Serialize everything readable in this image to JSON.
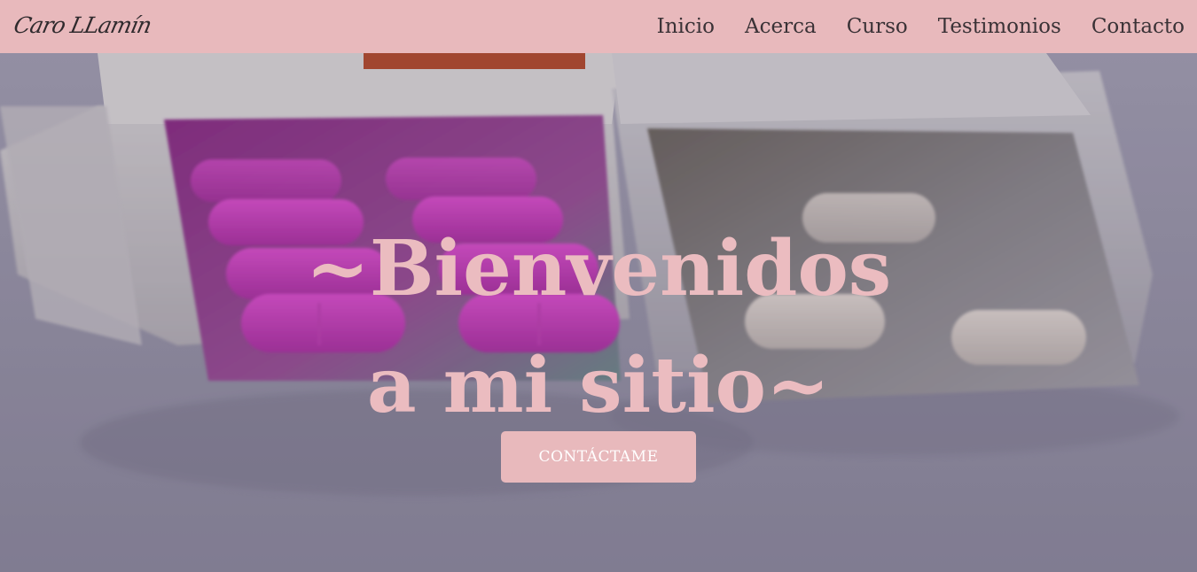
{
  "brand": {
    "name": "Caro LLamín"
  },
  "nav": {
    "items": [
      "Inicio",
      "Acerca",
      "Curso",
      "Testimonios",
      "Contacto"
    ]
  },
  "hero": {
    "title_line1": "~Bienvenidos",
    "title_line2": "a mi sitio~",
    "cta_label": "CONTÁCTAME"
  },
  "colors": {
    "navbar_bg": "#e8b9bc",
    "title_color": "#ebbcc0",
    "button_bg": "#e8b9bc",
    "button_text": "#ffffff",
    "nav_text": "#3a3236"
  }
}
